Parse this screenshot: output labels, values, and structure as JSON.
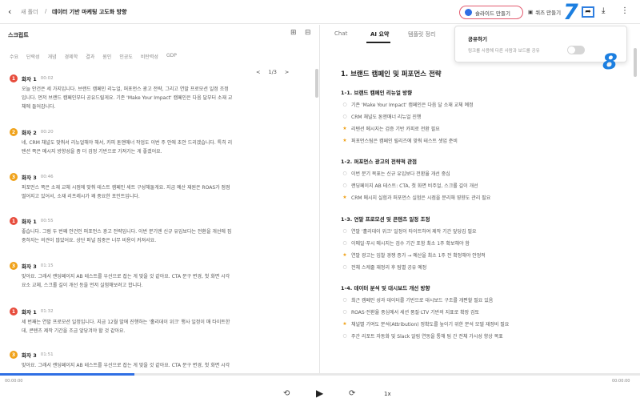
{
  "header": {
    "back_icon": "chevron-left-icon",
    "folder": "새 폴더",
    "separator": "/",
    "title": "데이터 기반 마케팅 고도화 방향",
    "slide_button": "슬라이드 만들기",
    "quiz_button": "퀴즈 만들기",
    "annotation_share": "7",
    "annotation_toggle": "8"
  },
  "script": {
    "title": "스크립트",
    "keywords": [
      "수요",
      "단락성",
      "개념",
      "경제학",
      "결과",
      "원인",
      "인공도",
      "비탄력성",
      "GDP"
    ],
    "pager": {
      "prev": "<",
      "page": "1/3",
      "next": ">"
    },
    "messages": [
      {
        "speaker": "화자 1",
        "time": "00:02",
        "color": "red",
        "text1": "오늘 안건은 세 가지입니다. 브랜드 캠페인 리뉴얼, 퍼포먼스 광고 전략, 그리고 연말 프로모션 일정 조정",
        "text2": "입니다. 먼저 브랜드 캠페인부터 공유드릴게요. 기존 'Make Your Impact' 캠페인은 다음 달부터 소재 교",
        "text3": "체에 들어갑니다."
      },
      {
        "speaker": "화자 2",
        "time": "00:20",
        "color": "orange",
        "text1": "네, CRM 채널도 맞춰서 리뉴얼해야 해서, 카피 톤앤매너 작업도 이번 주 안에 초안 드리겠습니다. 특히 리",
        "text2": "텐션 쪽은 메시지 방향성을 좀 더 검정 기반으로 가져가는 게 좋겠어요.",
        "text3": ""
      },
      {
        "speaker": "화자 3",
        "time": "00:46",
        "color": "orange",
        "text1": "퍼포먼스 쪽은 소재 교체 시점에 맞춰 테스트 캠페인 세트 구성해둘게요. 지금 예산 재원은 ROAS가 점점",
        "text2": "떨어지고 있어서, 소재 리프레시가 꽤 중요한 포인트입니다.",
        "text3": ""
      },
      {
        "speaker": "화자 1",
        "time": "00:55",
        "color": "red",
        "text1": "좋습니다. 그럼 두 번째 안건인 퍼포먼스 광고 전략입니다. 이번 분기엔 신규 유입보다는 전환을 개선에 집",
        "text2": "중하자는 의견이 많았어요. 상단 퍼널 집중은 너무 비용이 커져서요.",
        "text3": ""
      },
      {
        "speaker": "화자 3",
        "time": "01:15",
        "color": "orange",
        "text1": "맞아요. 그래서 랜딩페이지 AB 테스트를 우선으로 잡는 게 맞을 것 같아요. CTA 문구 변경, 첫 화면 시각",
        "text2": "요소 교체, 스크롤 길이 개선 등을 먼저 실험해보려고 합니다.",
        "text3": ""
      },
      {
        "speaker": "화자 1",
        "time": "01:32",
        "color": "red",
        "text1": "세 번째는 연말 프로모션 일정입니다. 지금 12월 말에 진행하는 '홀리데이 위크' 행사 일정이 매 타이트한",
        "text2": "데, 콘텐츠 제작 기간을 조금 앞당겨야 할 것 같아요.",
        "text3": ""
      },
      {
        "speaker": "화자 3",
        "time": "01:51",
        "color": "orange",
        "text1": "맞아요. 그래서 랜딩페이지 AB 테스트를 우선으로 잡는 게 맞을 것 같아요. CTA 문구 변경, 첫 화면 시각",
        "text2": "",
        "text3": ""
      }
    ]
  },
  "tabs": [
    "Chat",
    "AI 요약",
    "템플릿 정리"
  ],
  "summary": {
    "title": "1. 브랜드 캠페인 및 퍼포먼스 전략",
    "sections": [
      {
        "heading": "1-1. 브랜드 캠페인 리뉴얼 방향",
        "items": [
          {
            "bullet": "○",
            "text": "기존 'Make Your Impact' 캠페인은 다음 달 소재 교체 예정"
          },
          {
            "bullet": "○",
            "text": "CRM 채널도 톤앤매너 리뉴얼 진행"
          },
          {
            "bullet": "★",
            "text": "리텐션 메시지는 검증 기반 카피로 전환 필요"
          },
          {
            "bullet": "★",
            "text": "퍼포먼스팀은 캠페인 릴리즈에 맞춰 테스트 셋업 준비"
          }
        ]
      },
      {
        "heading": "1-2. 퍼포먼스 광고의 전략적 관점",
        "items": [
          {
            "bullet": "○",
            "text": "이번 분기 목표는 신규 유입보다 전환율 개선 중심"
          },
          {
            "bullet": "○",
            "text": "랜딩페이지 AB 테스트: CTA, 첫 화면 비주얼, 스크롤 길이 개선"
          },
          {
            "bullet": "★",
            "text": "CRM 메시지 실험과 퍼포먼스 실험은 시점을 분리해 영향도 관리 필요"
          }
        ]
      },
      {
        "heading": "1-3. 연말 프로모션 및 콘텐츠 일정 조정",
        "items": [
          {
            "bullet": "○",
            "text": "연말 '홀리데이 위크' 일정이 타이트하여 제작 기간 앞당김 필요"
          },
          {
            "bullet": "○",
            "text": "이메일·푸시 메시지는 검수 기간 포함 최소 1주 확보해야 함"
          },
          {
            "bullet": "★",
            "text": "연말 광고는 입찰 경쟁 증가 → 예산을 최소 1주 전 확정해야 안정적"
          },
          {
            "bullet": "○",
            "text": "전체 스케줄 재정리 후 팀별 공유 예정"
          }
        ]
      },
      {
        "heading": "1-4. 데이터 분석 및 대시보드 개선 방향",
        "items": [
          {
            "bullet": "○",
            "text": "최근 캠페인 성과 데이터를 기반으로 대시보드 구조를 개편할 필요 있음"
          },
          {
            "bullet": "○",
            "text": "ROAS·전환율 중심에서 세션 품질·LTV 기반의 지표로 확장 검토"
          },
          {
            "bullet": "★",
            "text": "채널별 기여도 분석(Attribution) 정확도를 높이기 위한 분석 모델 재정비 필요"
          },
          {
            "bullet": "○",
            "text": "주간 리포트 자동화 및 Slack 알림 연동을 통해 팀 간 전체 가시성 향상 목표"
          }
        ]
      }
    ]
  },
  "share_popup": {
    "title": "공유하기",
    "description": "링크를 사용해 다른 사람과 보드를 공유",
    "toggle_on": false
  },
  "player": {
    "time_start": "00:00:00",
    "time_end": "00:00:00",
    "speed": "1x",
    "progress": 0.21
  }
}
